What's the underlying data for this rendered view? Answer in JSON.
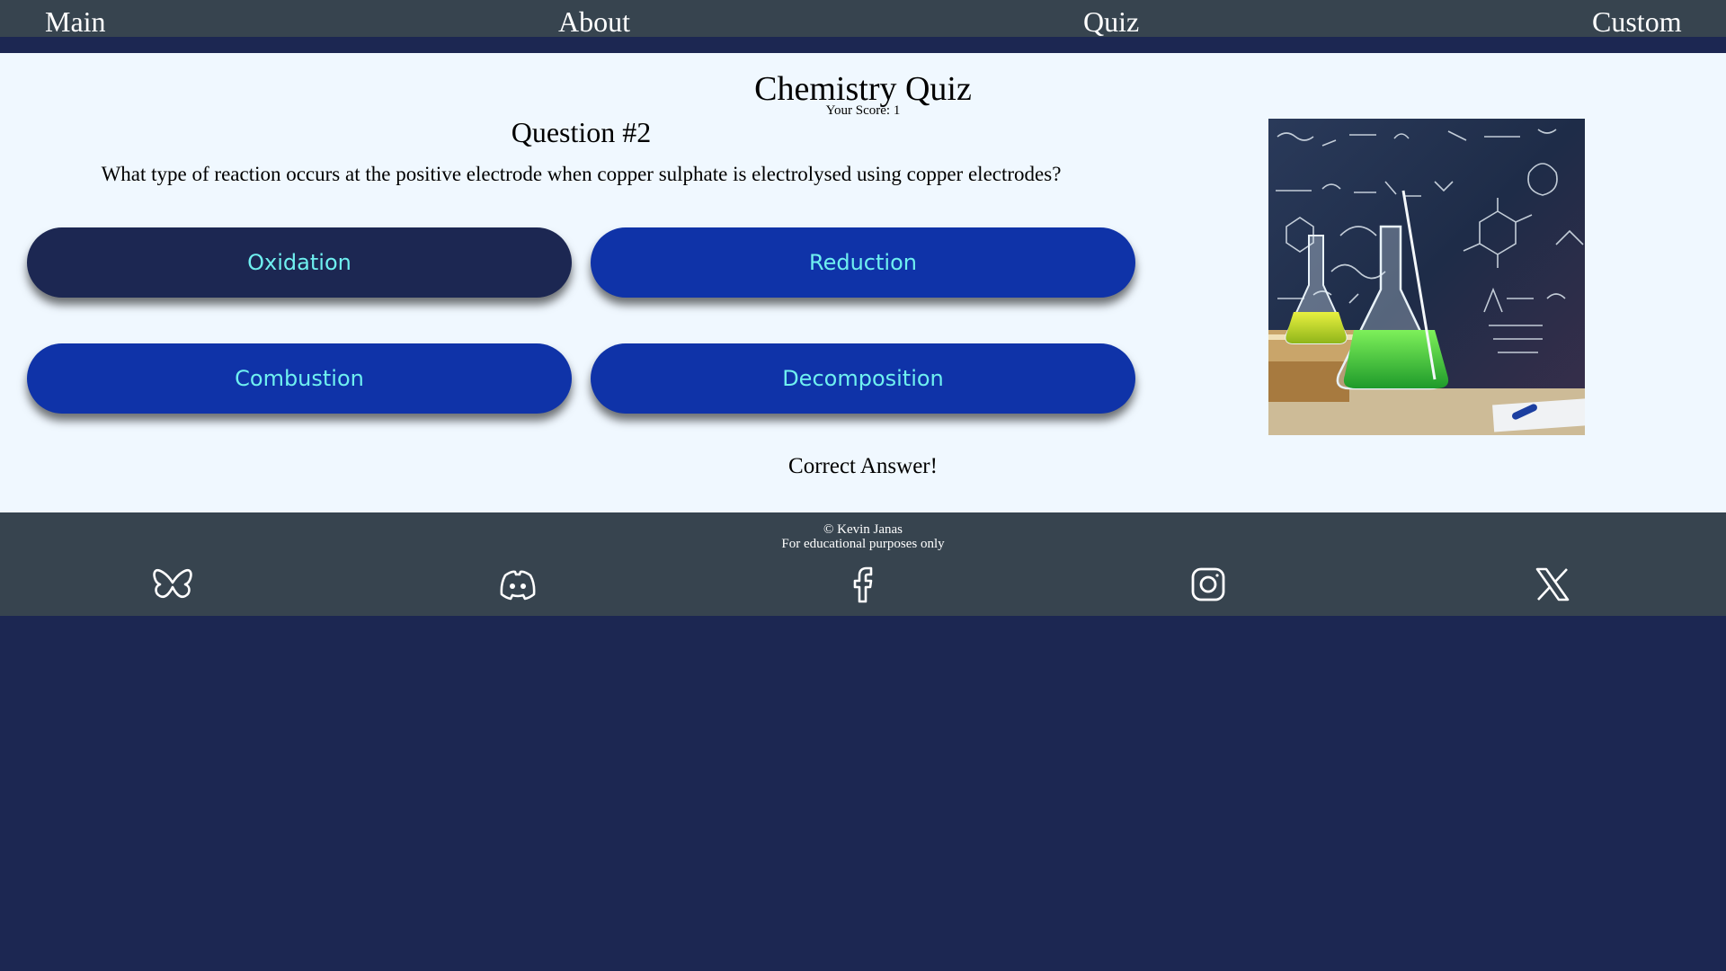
{
  "nav": {
    "items": [
      {
        "label": "Main"
      },
      {
        "label": "About"
      },
      {
        "label": "Quiz"
      },
      {
        "label": "Custom"
      }
    ]
  },
  "quiz": {
    "title": "Chemistry Quiz",
    "score": "Your Score: 1",
    "question_number": "Question #2",
    "question": "What type of reaction occurs at the positive electrode when copper sulphate is electrolysed using copper electrodes?",
    "answers": [
      {
        "label": "Oxidation",
        "selected": true
      },
      {
        "label": "Reduction",
        "selected": false
      },
      {
        "label": "Combustion",
        "selected": false
      },
      {
        "label": "Decomposition",
        "selected": false
      }
    ],
    "result": "Correct Answer!"
  },
  "footer": {
    "copyright": "© Kevin Janas",
    "note": "For educational purposes only",
    "social": [
      "bluesky-icon",
      "discord-icon",
      "facebook-icon",
      "instagram-icon",
      "x-icon"
    ]
  },
  "colors": {
    "nav_bg": "#37444f",
    "page_bg": "#1c2752",
    "content_bg": "#f0f8ff",
    "answer_bg": "#0f33a8",
    "answer_selected_bg": "#1c2752",
    "answer_text": "#6ff0f0"
  }
}
